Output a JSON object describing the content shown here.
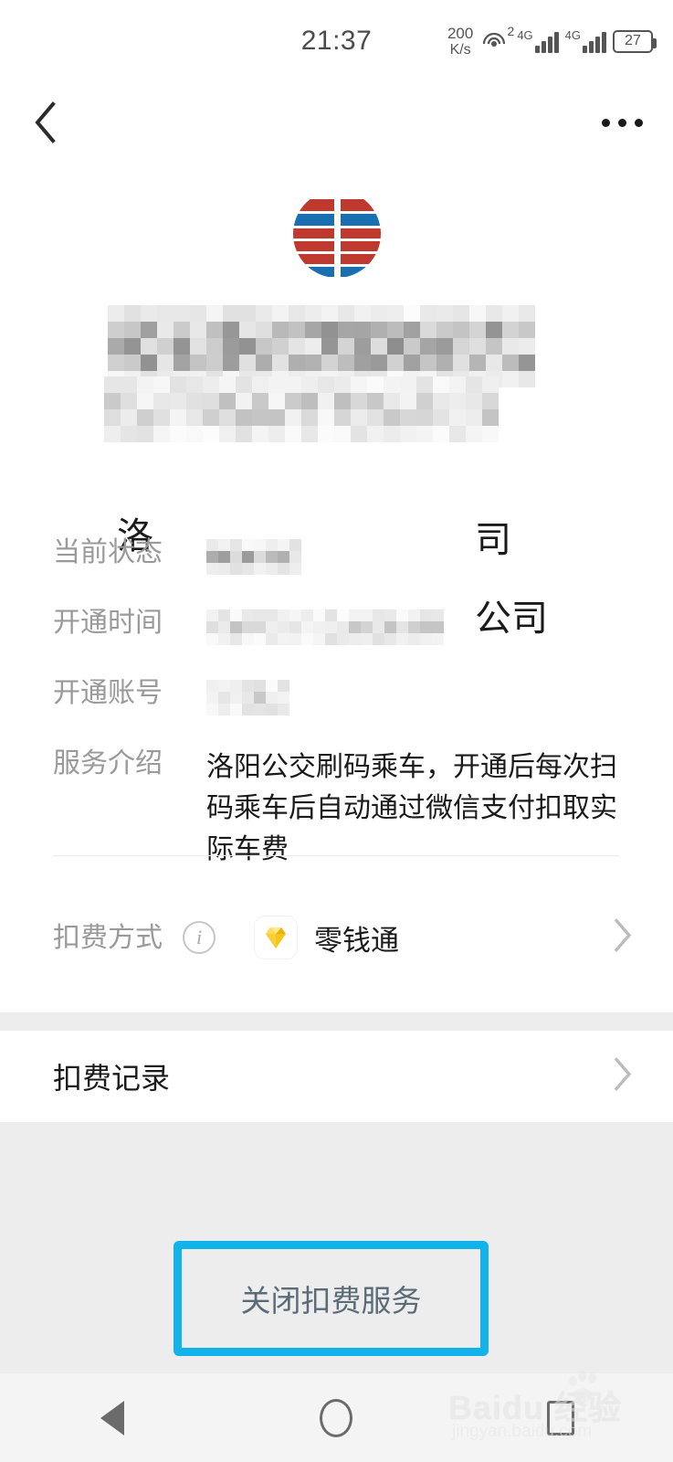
{
  "status_bar": {
    "time": "21:37",
    "net_speed_value": "200",
    "net_speed_unit": "K/s",
    "hotspot_count": "2",
    "sim1_network": "4G",
    "sim2_network": "4G",
    "battery_level": "27"
  },
  "app_bar": {
    "back_icon": "chevron-left-icon",
    "more_icon": "more-horizontal-icon"
  },
  "brand": {
    "logo_icon": "bus-company-logo",
    "logo_colors": {
      "red": "#c0392f",
      "blue": "#1a6fb0"
    },
    "name_line1_redacted": "[马赛克]",
    "name_line2_redacted": "[马赛克]",
    "name_line1_visible_start": "洛",
    "name_line1_visible_end": "司",
    "name_line2_visible_end": "公司"
  },
  "info_rows": [
    {
      "label": "当前状态",
      "value": "",
      "redacted": true
    },
    {
      "label": "开通时间",
      "value": "",
      "redacted": true
    },
    {
      "label": "开通账号",
      "value": "",
      "redacted": true
    },
    {
      "label": "服务介绍",
      "value": "洛阳公交刷码乘车，开通后每次扫码乘车后自动通过微信支付扣取实际车费",
      "redacted": false
    }
  ],
  "pay_method": {
    "label": "扣费方式",
    "info_icon": "info-circle-icon",
    "wallet_icon": "diamond-gem-icon",
    "wallet_name": "零钱通",
    "chevron_icon": "chevron-right-icon"
  },
  "records_row": {
    "label": "扣费记录",
    "chevron_icon": "chevron-right-icon"
  },
  "close_service": {
    "label": "关闭扣费服务",
    "highlight_color": "#12b2ea",
    "text_color": "#5b6b78"
  },
  "system_nav": {
    "back_icon": "triangle-back-icon",
    "home_icon": "circle-home-icon",
    "recents_icon": "square-recents-icon"
  },
  "watermark": {
    "brand": "Baidu 经验",
    "url": "jingyan.baidu.com"
  },
  "mosaic": {
    "title1_cells": 260,
    "title2_cells": 216
  }
}
